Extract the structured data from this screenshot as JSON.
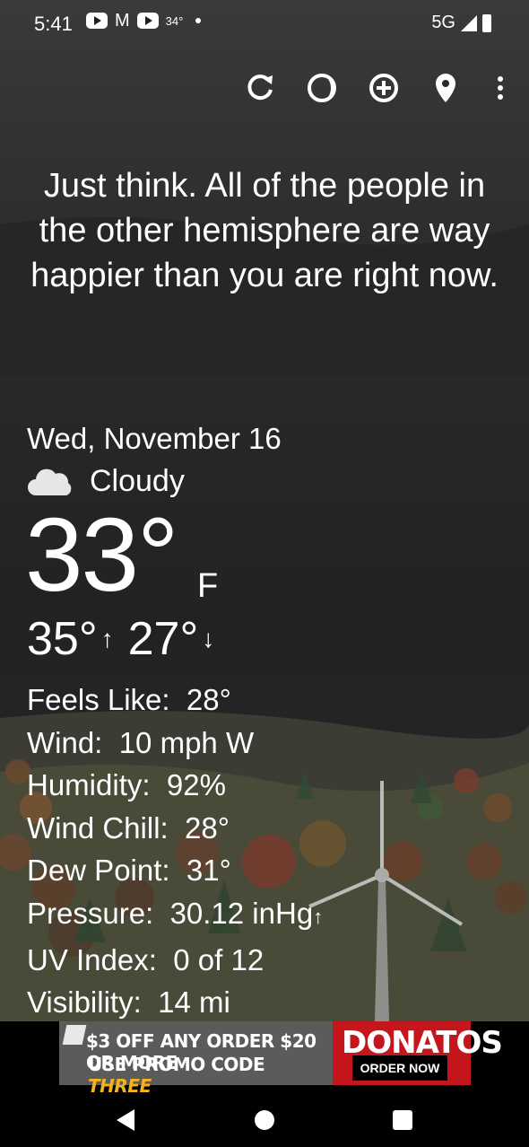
{
  "status_bar": {
    "time": "5:41",
    "temp": "34°",
    "network": "5G"
  },
  "toolbar": {
    "icons": [
      "refresh-icon",
      "theme-icon",
      "add-location-icon",
      "location-pin-icon",
      "more-vert-icon"
    ]
  },
  "quote": "Just think. All of the people in the other hemisphere are way happier than you are right now.",
  "weather": {
    "date": "Wed, November 16",
    "condition": "Cloudy",
    "condition_icon": "cloud-icon",
    "temperature": "33°",
    "unit": "F",
    "high": "35°",
    "low": "27°",
    "details": [
      {
        "label": "Feels Like:",
        "value": "28°"
      },
      {
        "label": "Wind:",
        "value": "10 mph W"
      },
      {
        "label": "Humidity:",
        "value": "92%"
      },
      {
        "label": "Wind Chill:",
        "value": "28°"
      },
      {
        "label": "Dew Point:",
        "value": "31°"
      },
      {
        "label": "Pressure:",
        "value": "30.12 inHg"
      },
      {
        "label": "UV Index:",
        "value": "0 of 12"
      },
      {
        "label": "Visibility:",
        "value": "14 mi"
      }
    ]
  },
  "ad": {
    "line1": "$3 OFF ANY ORDER $20 OR MORE",
    "line2_prefix": "USE PROMO CODE",
    "promo_code": "THREE",
    "brand": "DONATOS",
    "cta": "ORDER NOW",
    "colors": {
      "brand_red": "#c4161c",
      "code_yellow": "#f3b320"
    }
  }
}
